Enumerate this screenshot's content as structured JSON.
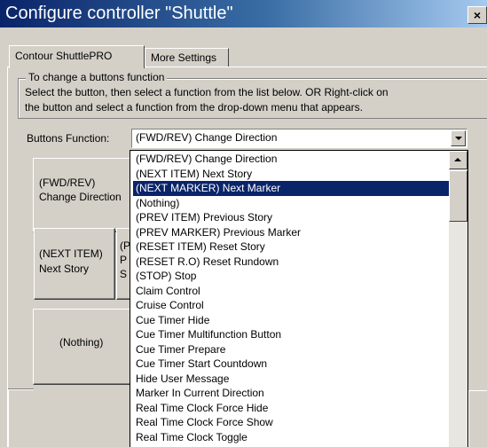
{
  "window": {
    "title": "Configure controller \"Shuttle\"",
    "close_glyph": "×"
  },
  "tabs": [
    {
      "label": "Contour ShuttlePRO",
      "active": true
    },
    {
      "label": "More Settings",
      "active": false
    }
  ],
  "instructions": {
    "legend": "To change a buttons function",
    "line1": "Select the button, then select a function from the list below. OR Right-click on",
    "line2": "the button and select a function from the drop-down menu that appears."
  },
  "buttons_function": {
    "label": "Buttons Function:",
    "value": "(FWD/REV) Change Direction"
  },
  "controller_buttons": [
    {
      "line1": "(FWD/REV)",
      "line2": "Change Direction"
    },
    {
      "line1": "(NEXT ITEM)",
      "line2": "Next Story"
    },
    {
      "line1": "(P",
      "line2": "P",
      "line3": "S"
    },
    {
      "line1": "(Nothing)"
    }
  ],
  "dropdown": {
    "selected_index": 2,
    "options": [
      "(FWD/REV) Change Direction",
      "(NEXT ITEM) Next Story",
      "(NEXT MARKER) Next Marker",
      "(Nothing)",
      "(PREV ITEM) Previous Story",
      "(PREV MARKER) Previous Marker",
      "(RESET ITEM) Reset Story",
      "(RESET R.O) Reset Rundown",
      "(STOP) Stop",
      "Claim Control",
      "Cruise Control",
      "Cue Timer Hide",
      "Cue Timer Multifunction Button",
      "Cue Timer Prepare",
      "Cue Timer Start Countdown",
      "Hide User Message",
      "Marker In Current Direction",
      "Real Time Clock Force Hide",
      "Real Time Clock Force Show",
      "Real Time Clock Toggle"
    ]
  },
  "colors": {
    "title_bar_start": "#0a246a",
    "title_bar_end": "#a6caf0",
    "selection": "#0a246a",
    "face": "#d4d0c8"
  },
  "icons": {
    "close": "close-icon",
    "combo_arrow": "chevron-down-icon",
    "scroll_up": "chevron-up-icon"
  }
}
